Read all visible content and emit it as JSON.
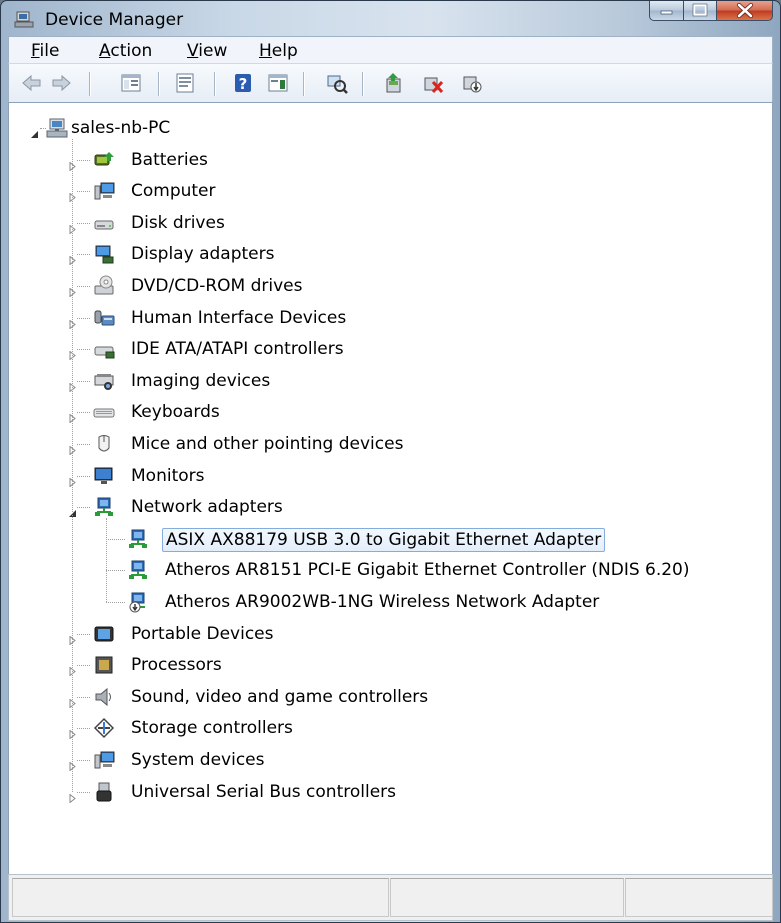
{
  "window": {
    "title": "Device Manager"
  },
  "menubar": {
    "items": [
      {
        "key": "file",
        "label": "File",
        "acc": "F",
        "rest": "ile"
      },
      {
        "key": "action",
        "label": "Action",
        "acc": "A",
        "rest": "ction"
      },
      {
        "key": "view",
        "label": "View",
        "acc": "V",
        "rest": "iew"
      },
      {
        "key": "help",
        "label": "Help",
        "acc": "H",
        "rest": "elp"
      }
    ]
  },
  "toolbar": {
    "buttons": [
      {
        "name": "back-button",
        "icon": "arrow-left-icon"
      },
      {
        "name": "forward-button",
        "icon": "arrow-right-icon"
      },
      {
        "name": "show-hide-console-tree-button",
        "icon": "console-tree-icon"
      },
      {
        "name": "properties-button",
        "icon": "properties-icon"
      },
      {
        "name": "help-button",
        "icon": "help-icon"
      },
      {
        "name": "show-action-pane-button",
        "icon": "action-pane-icon"
      },
      {
        "name": "scan-hardware-changes-button",
        "icon": "scan-hardware-icon"
      },
      {
        "name": "update-driver-button",
        "icon": "update-driver-icon"
      },
      {
        "name": "uninstall-button",
        "icon": "uninstall-icon"
      },
      {
        "name": "disable-button",
        "icon": "disable-icon"
      }
    ]
  },
  "tree": {
    "root": {
      "label": "sales-nb-PC",
      "icon": "computer-network-icon",
      "expanded": true
    },
    "categories": [
      {
        "label": "Batteries",
        "icon": "battery-icon"
      },
      {
        "label": "Computer",
        "icon": "computer-icon"
      },
      {
        "label": "Disk drives",
        "icon": "disk-drive-icon"
      },
      {
        "label": "Display adapters",
        "icon": "display-adapter-icon"
      },
      {
        "label": "DVD/CD-ROM drives",
        "icon": "dvd-drive-icon"
      },
      {
        "label": "Human Interface Devices",
        "icon": "hid-icon"
      },
      {
        "label": "IDE ATA/ATAPI controllers",
        "icon": "ide-controller-icon"
      },
      {
        "label": "Imaging devices",
        "icon": "imaging-icon"
      },
      {
        "label": "Keyboards",
        "icon": "keyboard-icon"
      },
      {
        "label": "Mice and other pointing devices",
        "icon": "mouse-icon"
      },
      {
        "label": "Monitors",
        "icon": "monitor-icon"
      },
      {
        "label": "Network adapters",
        "icon": "network-adapter-icon",
        "expanded": true,
        "children": [
          {
            "label": "ASIX AX88179 USB 3.0 to Gigabit Ethernet Adapter",
            "icon": "network-adapter-icon",
            "selected": true
          },
          {
            "label": "Atheros AR8151 PCI-E Gigabit Ethernet Controller (NDIS 6.20)",
            "icon": "network-adapter-icon"
          },
          {
            "label": "Atheros AR9002WB-1NG Wireless Network Adapter",
            "icon": "network-adapter-disabled-icon"
          }
        ]
      },
      {
        "label": "Portable Devices",
        "icon": "portable-device-icon"
      },
      {
        "label": "Processors",
        "icon": "processor-icon"
      },
      {
        "label": "Sound, video and game controllers",
        "icon": "speaker-icon"
      },
      {
        "label": "Storage controllers",
        "icon": "storage-controller-icon"
      },
      {
        "label": "System devices",
        "icon": "system-devices-icon"
      },
      {
        "label": "Universal Serial Bus controllers",
        "icon": "usb-icon"
      }
    ]
  },
  "colors": {
    "selection_border": "#84acdd",
    "close_button": "#c0391f"
  }
}
